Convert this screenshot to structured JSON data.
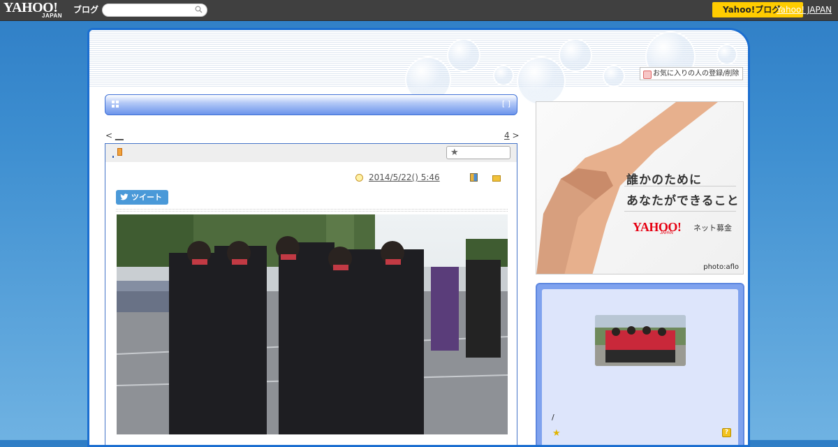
{
  "topbar": {
    "logo_main": "YAHOO!",
    "logo_sub": "JAPAN",
    "logo_blog": "ブログ",
    "search_placeholder": "",
    "search_icon": "search-icon",
    "yahoo_button_label": "Yahoo!ブログ",
    "yahoo_link": "Yahoo! JAPAN"
  },
  "header": {
    "favorite_label": "お気に入りの人の登録/削除"
  },
  "article_bar": {
    "brackets": "[ ]"
  },
  "nav": {
    "prev": "<",
    "prev_link": "__",
    "next_num": "4",
    "next": ">"
  },
  "entry": {
    "date_time": "2014/5/22()  5:46",
    "tweet_label": "ツイート",
    "star_icon": "star-icon"
  },
  "ad": {
    "line1": "誰かのために",
    "line2": "あなたができること",
    "logo": "YAHOO!",
    "logo_sub": "JAPAN",
    "service": "ネット募金",
    "credit": "photo:aflo"
  },
  "profile": {
    "slash": "/",
    "star_icon": "star-icon",
    "help_icon": "?"
  },
  "colors": {
    "frame_blue": "#1b6ed0",
    "page_bg": "#3d8ed0",
    "yahoo_yellow": "#ffcc00",
    "tweet_blue": "#4a99d8"
  }
}
